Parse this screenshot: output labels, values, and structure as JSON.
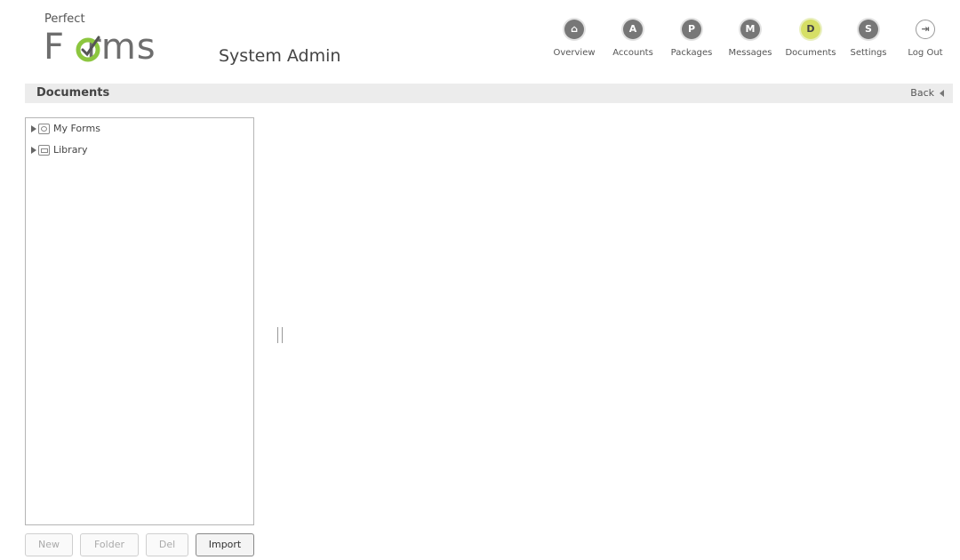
{
  "app": {
    "logo_top": "Perfect",
    "logo_bottom": "Forms",
    "title": "System Admin"
  },
  "nav": {
    "items": [
      {
        "icon": "home-icon",
        "glyph": "⌂",
        "label": "Overview"
      },
      {
        "icon": "accounts-icon",
        "glyph": "A",
        "label": "Accounts"
      },
      {
        "icon": "packages-icon",
        "glyph": "P",
        "label": "Packages"
      },
      {
        "icon": "messages-icon",
        "glyph": "M",
        "label": "Messages"
      },
      {
        "icon": "documents-icon",
        "glyph": "D",
        "label": "Documents",
        "active": true
      },
      {
        "icon": "settings-icon",
        "glyph": "S",
        "label": "Settings"
      },
      {
        "icon": "logout-icon",
        "glyph": "⇥",
        "label": "Log Out"
      }
    ]
  },
  "section": {
    "title": "Documents",
    "back_label": "Back"
  },
  "tree": {
    "items": [
      {
        "label": "My Forms",
        "icon": "my-forms-icon"
      },
      {
        "label": "Library",
        "icon": "library-icon"
      }
    ]
  },
  "buttons": {
    "new": "New",
    "folder": "Folder",
    "del": "Del",
    "import": "Import"
  },
  "colors": {
    "active_nav": "#d6df66",
    "nav_icon": "#777777",
    "section_bar": "#ececec"
  }
}
